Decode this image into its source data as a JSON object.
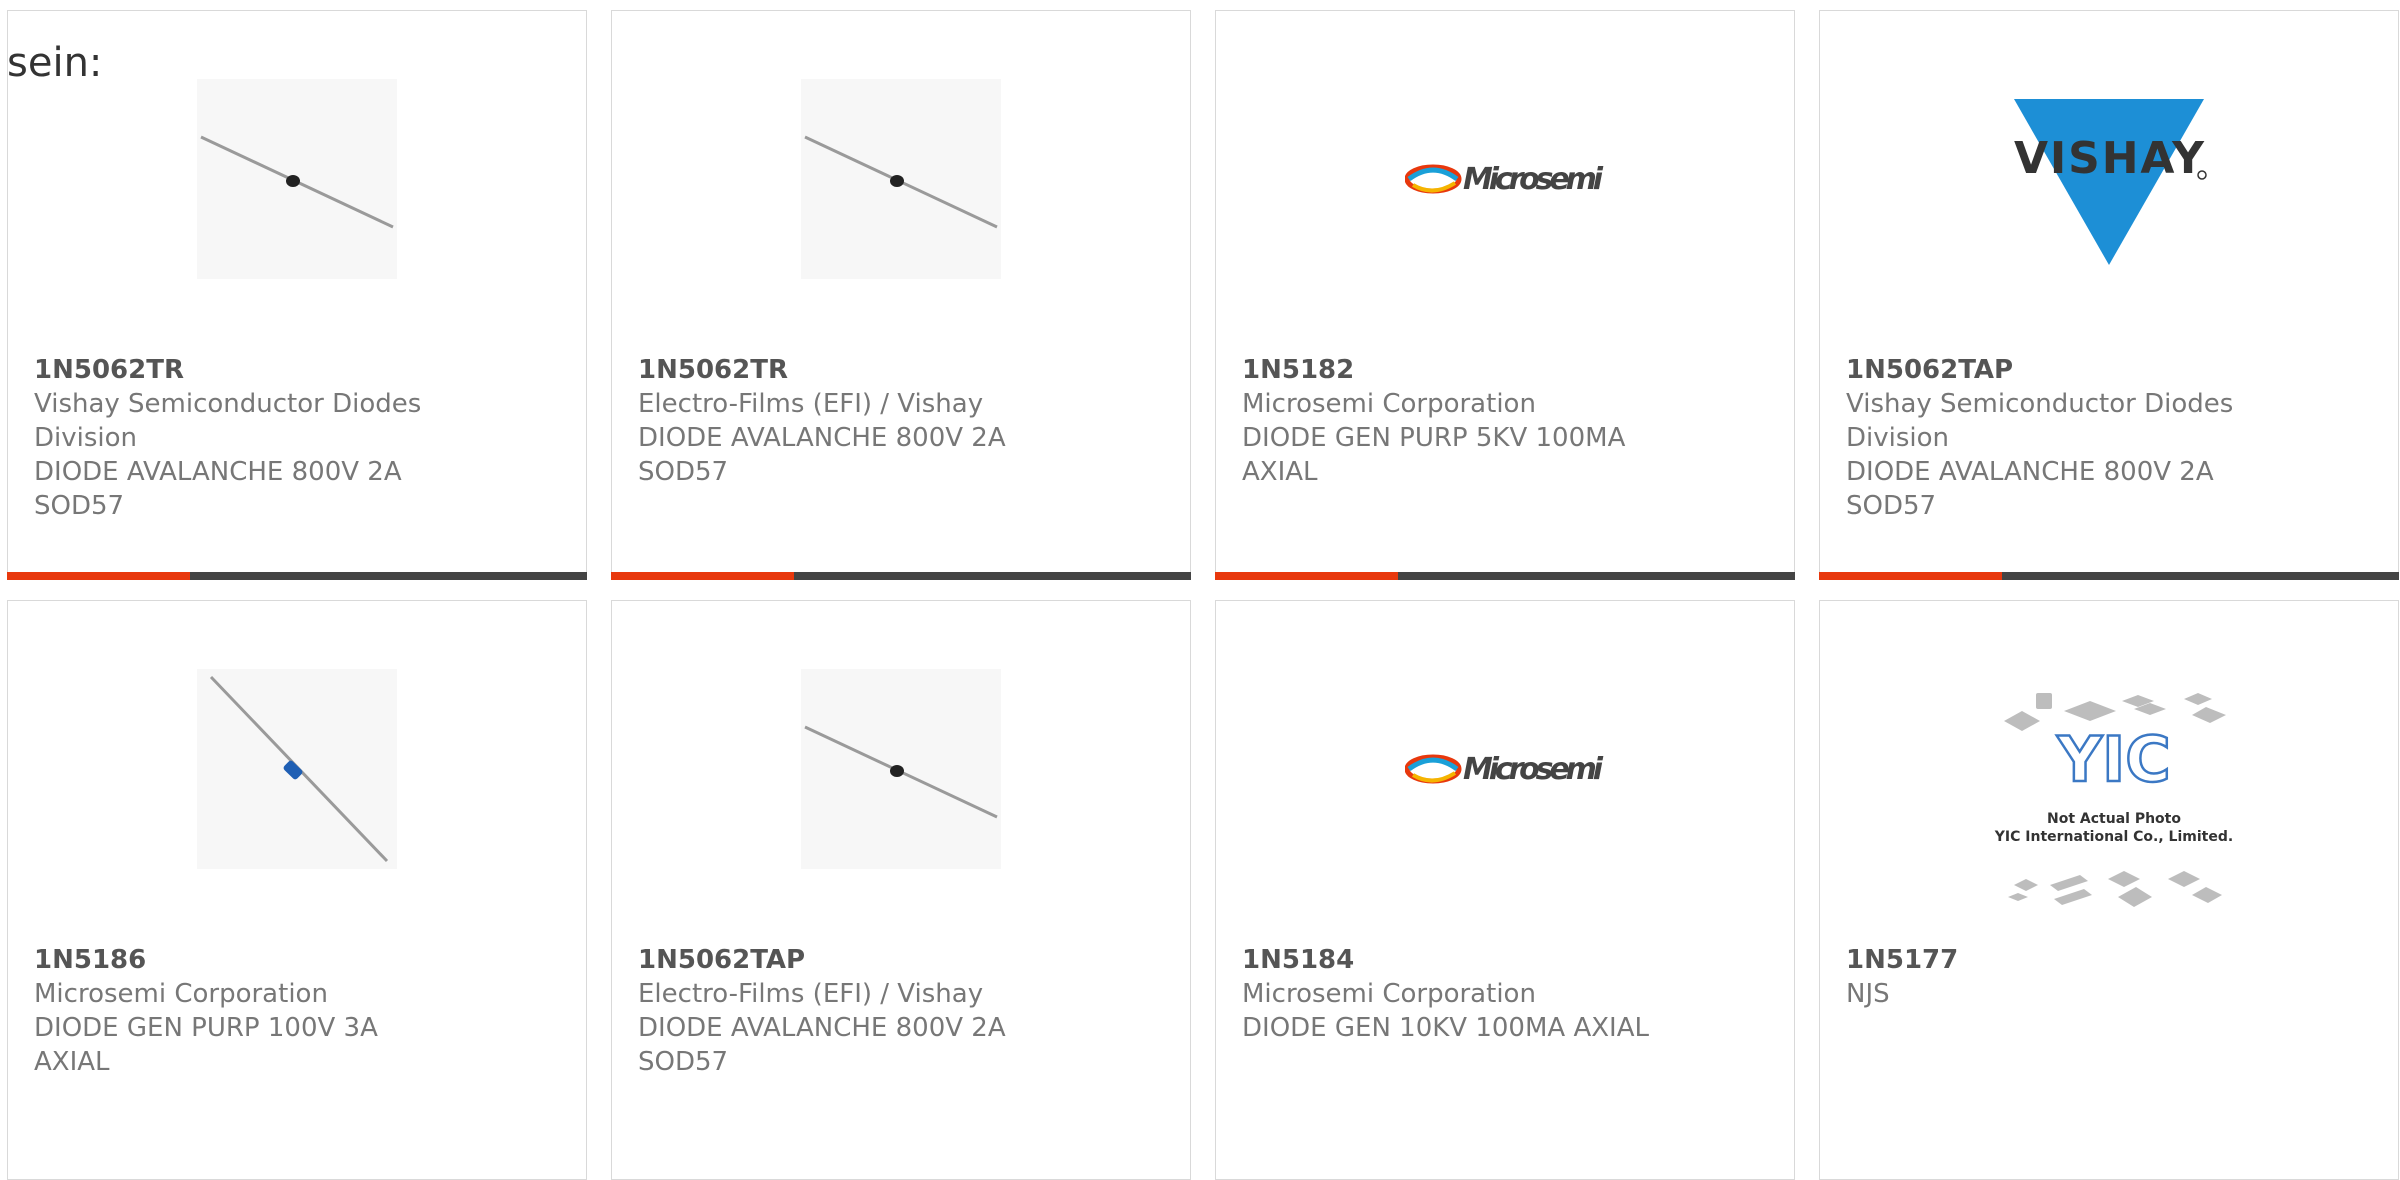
{
  "heading": "sein:",
  "colors": {
    "accent": "#e8380d",
    "bar": "#444444",
    "card_border": "#d9d9d9"
  },
  "products": [
    {
      "part": "1N5062TR",
      "manufacturer": "Vishay Semiconductor Diodes Division",
      "description": "DIODE AVALANCHE 800V 2A SOD57",
      "image": "axial-diode-black-band"
    },
    {
      "part": "1N5062TR",
      "manufacturer": "Electro-Films (EFI) / Vishay",
      "description": "DIODE AVALANCHE 800V 2A SOD57",
      "image": "axial-diode-black-band"
    },
    {
      "part": "1N5182",
      "manufacturer": "Microsemi Corporation",
      "description": "DIODE GEN PURP 5KV 100MA AXIAL",
      "image": "microsemi-logo",
      "logo_text": "Microsemi"
    },
    {
      "part": "1N5062TAP",
      "manufacturer": "Vishay Semiconductor Diodes Division",
      "description": "DIODE AVALANCHE 800V 2A SOD57",
      "image": "vishay-logo",
      "logo_text": "VISHAY"
    },
    {
      "part": "1N5186",
      "manufacturer": "Microsemi Corporation",
      "description": "DIODE GEN PURP 100V 3A AXIAL",
      "image": "axial-diode-blue-band"
    },
    {
      "part": "1N5062TAP",
      "manufacturer": "Electro-Films (EFI) / Vishay",
      "description": "DIODE AVALANCHE 800V 2A SOD57",
      "image": "axial-diode-black-band"
    },
    {
      "part": "1N5184",
      "manufacturer": "Microsemi Corporation",
      "description": "DIODE GEN 10KV 100MA AXIAL",
      "image": "microsemi-logo",
      "logo_text": "Microsemi"
    },
    {
      "part": "1N5177",
      "manufacturer": "NJS",
      "description": "",
      "image": "yic-placeholder",
      "logo_text": "YIC",
      "caption_1": "Not Actual Photo",
      "caption_2": "YIC International Co., Limited."
    }
  ]
}
